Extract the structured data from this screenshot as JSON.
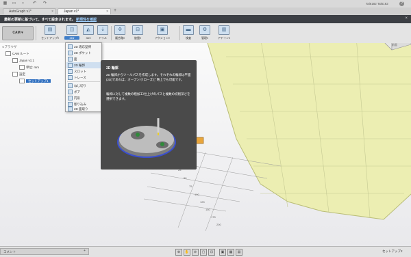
{
  "app": {
    "user_label": "Tai6182 Tai6182",
    "help_label": "?"
  },
  "tabs": [
    {
      "label": "AutoGraph v1*"
    },
    {
      "label": "Japan v1*"
    }
  ],
  "notice": {
    "text": "最新の更新に基づいて、すべて設定されます。",
    "link": "新規性を確認"
  },
  "workspace": {
    "label": "CAM ▾"
  },
  "toolbar": [
    {
      "label": "セットアップ▾",
      "icon": "setup-icon"
    },
    {
      "label": "2D▾",
      "icon": "2d-icon"
    },
    {
      "label": "3D▾",
      "icon": "3d-icon"
    },
    {
      "label": "ドリル",
      "icon": "drill-icon"
    },
    {
      "label": "複合軸▾",
      "icon": "multiaxis-icon"
    },
    {
      "label": "旋盤▾",
      "icon": "turning-icon"
    },
    {
      "label": "アクション▾",
      "icon": "action-icon"
    },
    {
      "label": "検査",
      "icon": "inspect-icon"
    },
    {
      "label": "管理▾",
      "icon": "manage-icon"
    },
    {
      "label": "アドイン▾",
      "icon": "addin-icon"
    }
  ],
  "browser": {
    "title": "ブラウザ",
    "rows": [
      "CAM ルート",
      "Japan v1:1",
      "単位: mm",
      "設定",
      "セットアップ1"
    ]
  },
  "dropdown": {
    "items": [
      "2D 適応型掃",
      "2D ポケット",
      "面",
      "2D 輪郭",
      "スロット",
      "トレース",
      "ねじ切り",
      "ボア",
      "円形",
      "彫り込み",
      "2D 面取り"
    ],
    "selected_index": 3
  },
  "tooltip": {
    "title": "2D 輪郭",
    "para1": "2D 輪郭からツールパスを作成します。それぞれの輪郭は平面(2D)であれば、オープン/クローズど 略上でも可能です。",
    "para2": "輪郭に対して複数の粗加工/仕上げのパスと複数の切削深さを選択できます。"
  },
  "viewcube": {
    "label": "前面"
  },
  "axis_ticks": [
    "25",
    "50",
    "75",
    "100",
    "125",
    "150",
    "175",
    "200"
  ],
  "status": {
    "comment": "コメント",
    "right": "セットアップ2"
  }
}
